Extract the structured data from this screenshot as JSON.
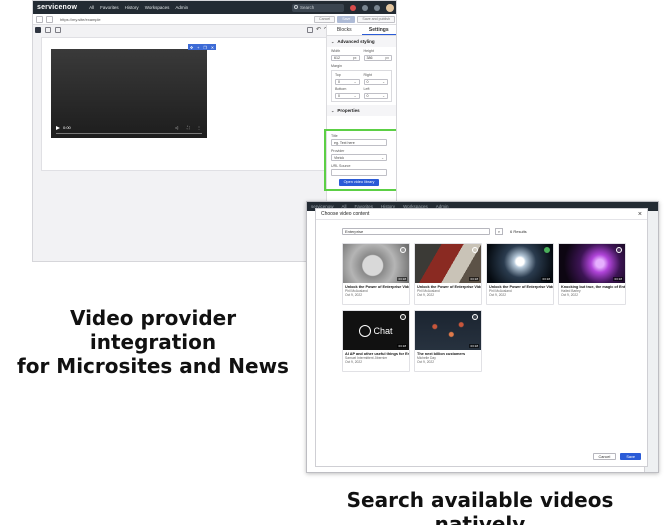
{
  "editor": {
    "brand": "servicenow",
    "nav_items": [
      "All",
      "Favorites",
      "History",
      "Workspaces",
      "Admin"
    ],
    "search_label": "Search",
    "url": "https://my.site/example",
    "url_buttons": [
      "Cancel",
      "Save",
      "Save and publish"
    ],
    "side_tabs": [
      "Blocks",
      "Settings"
    ],
    "advanced_styling": "Advanced styling",
    "width_label": "Width",
    "width_value": "612",
    "height_label": "Height",
    "height_value": "386",
    "unit": "px",
    "margin_label": "Margin",
    "margin_fields": [
      {
        "label": "Top",
        "value": "0"
      },
      {
        "label": "Right",
        "value": "0"
      },
      {
        "label": "Bottom",
        "value": "0"
      },
      {
        "label": "Left",
        "value": "0"
      }
    ],
    "properties_label": "Properties",
    "title_label": "Title",
    "title_placeholder": "eg. Text here",
    "provider_label": "Provider",
    "provider_value": "Vbrick",
    "video_source_label": "URL Source",
    "open_library_button": "Open video library",
    "video_time": "0:00"
  },
  "modal": {
    "bg_nav": [
      "servicenow",
      "All",
      "Favorites",
      "History",
      "Workspaces",
      "Admin"
    ],
    "title": "Choose video content",
    "search_value": "Enterprise",
    "results_count": "6 Results",
    "cancel_label": "Cancel",
    "save_label": "Save",
    "cards": [
      {
        "title": "Unlock the Power of Enterprise Video 1",
        "author": "Phil McAusland",
        "date": "Oct 9, 2022",
        "duration": "03:18",
        "thumb": "t1",
        "selected": false
      },
      {
        "title": "Unlock the Power of Enterprise Video 2",
        "author": "Phil McAusland",
        "date": "Oct 9, 2022",
        "duration": "03:18",
        "thumb": "t2",
        "selected": false
      },
      {
        "title": "Unlock the Power of Enterprise Video 3",
        "author": "Phil McAusland",
        "date": "Oct 9, 2022",
        "duration": "03:18",
        "thumb": "t3",
        "selected": true
      },
      {
        "title": "Knocking but true, the magic of Enter...",
        "author": "Hailed Barley",
        "date": "Oct 9, 2022",
        "duration": "03:18",
        "thumb": "t4",
        "selected": false
      },
      {
        "title": "AI AP and other useful things for Ente...",
        "author": "Samuel Intermittent Jibernier",
        "date": "Oct 9, 2022",
        "duration": "03:18",
        "thumb": "t5",
        "selected": false
      },
      {
        "title": "The next billion customers",
        "author": "Michelle Day",
        "date": "Oct 9, 2022",
        "duration": "03:18",
        "thumb": "t6",
        "selected": false
      }
    ],
    "chat_logo_text": "Chat"
  },
  "captions": {
    "left_line1": "Video provider integration",
    "left_line2": "for Microsites and News",
    "bottom": "Search available videos natively"
  }
}
